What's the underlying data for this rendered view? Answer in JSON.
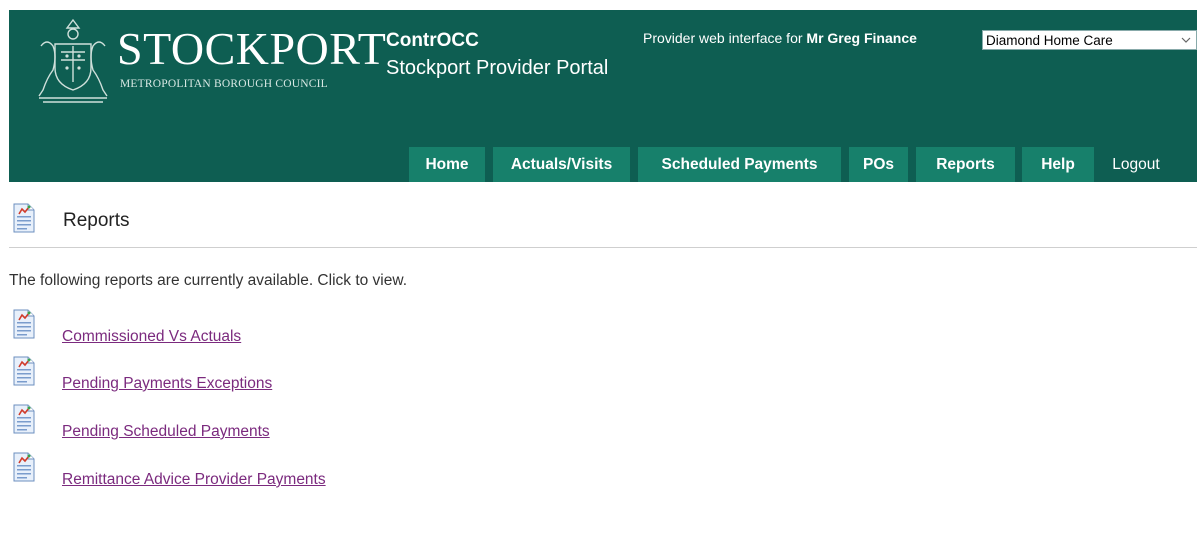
{
  "header": {
    "brand_name": "STOCKPORT",
    "brand_sub": "METROPOLITAN BOROUGH COUNCIL",
    "app_name": "ContrOCC",
    "portal_name": "Stockport Provider Portal",
    "provider_prefix": "Provider web interface for",
    "user_name": "Mr Greg Finance",
    "provider_selected": "Diamond Home Care"
  },
  "nav": {
    "tabs": [
      {
        "label": "Home"
      },
      {
        "label": "Actuals/Visits"
      },
      {
        "label": "Scheduled Payments"
      },
      {
        "label": "POs"
      },
      {
        "label": "Reports"
      },
      {
        "label": "Help"
      }
    ],
    "logout": "Logout"
  },
  "page": {
    "title": "Reports",
    "intro": "The following reports are currently available. Click to view."
  },
  "reports": [
    {
      "label": "Commissioned Vs Actuals"
    },
    {
      "label": "Pending Payments Exceptions"
    },
    {
      "label": "Pending Scheduled Payments"
    },
    {
      "label": "Remittance Advice Provider Payments"
    }
  ],
  "colors": {
    "header_bg": "#0e5e52",
    "tab_bg": "#17806b",
    "link": "#7b2a7e"
  }
}
